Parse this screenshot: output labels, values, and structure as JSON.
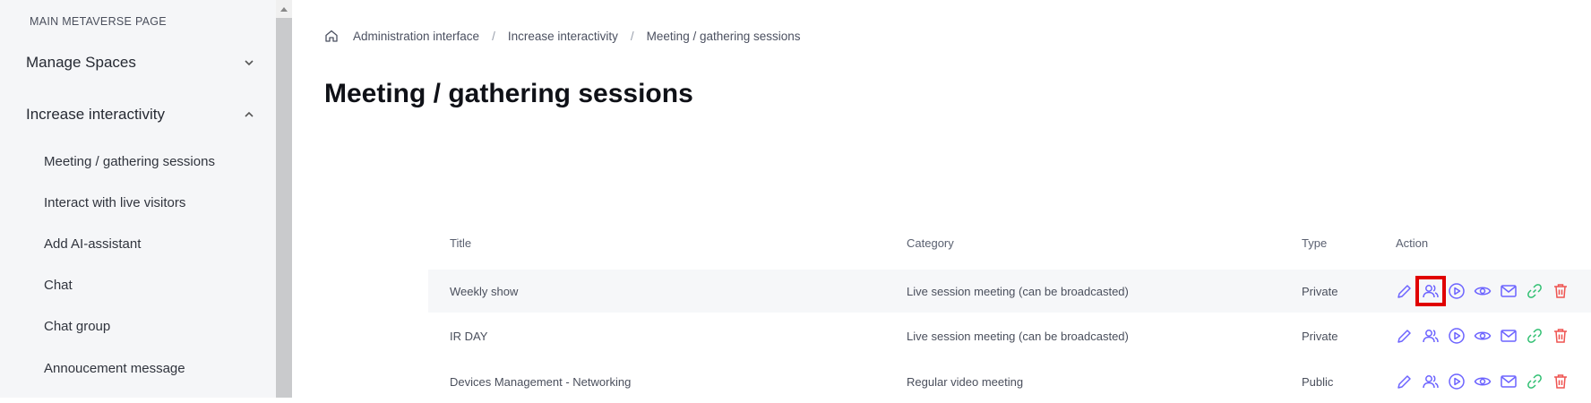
{
  "sidebar": {
    "section_label": "MAIN METAVERSE PAGE",
    "groups": [
      {
        "label": "Manage Spaces"
      },
      {
        "label": "Increase interactivity"
      }
    ],
    "items": [
      {
        "label": "Meeting / gathering sessions"
      },
      {
        "label": "Interact with live visitors"
      },
      {
        "label": "Add AI-assistant"
      },
      {
        "label": "Chat"
      },
      {
        "label": "Chat group"
      },
      {
        "label": "Annoucement message"
      }
    ]
  },
  "breadcrumb": {
    "items": [
      "Administration interface",
      "Increase interactivity",
      "Meeting / gathering sessions"
    ],
    "separator": "/"
  },
  "page": {
    "title": "Meeting / gathering sessions"
  },
  "table": {
    "headers": [
      "Title",
      "Category",
      "Type",
      "Action"
    ],
    "rows": [
      {
        "title": "Weekly show",
        "category": "Live session meeting (can be broadcasted)",
        "type": "Private"
      },
      {
        "title": "IR DAY",
        "category": "Live session meeting (can be broadcasted)",
        "type": "Private"
      },
      {
        "title": "Devices Management - Networking",
        "category": "Regular video meeting",
        "type": "Public"
      }
    ],
    "action_icons": [
      "edit-icon",
      "participants-icon",
      "play-icon",
      "view-icon",
      "email-icon",
      "link-icon",
      "delete-icon"
    ]
  },
  "colors": {
    "accent": "#6c63ff",
    "link_green": "#2fbf71",
    "delete_red": "#ef5350",
    "highlight": "#e00000"
  }
}
